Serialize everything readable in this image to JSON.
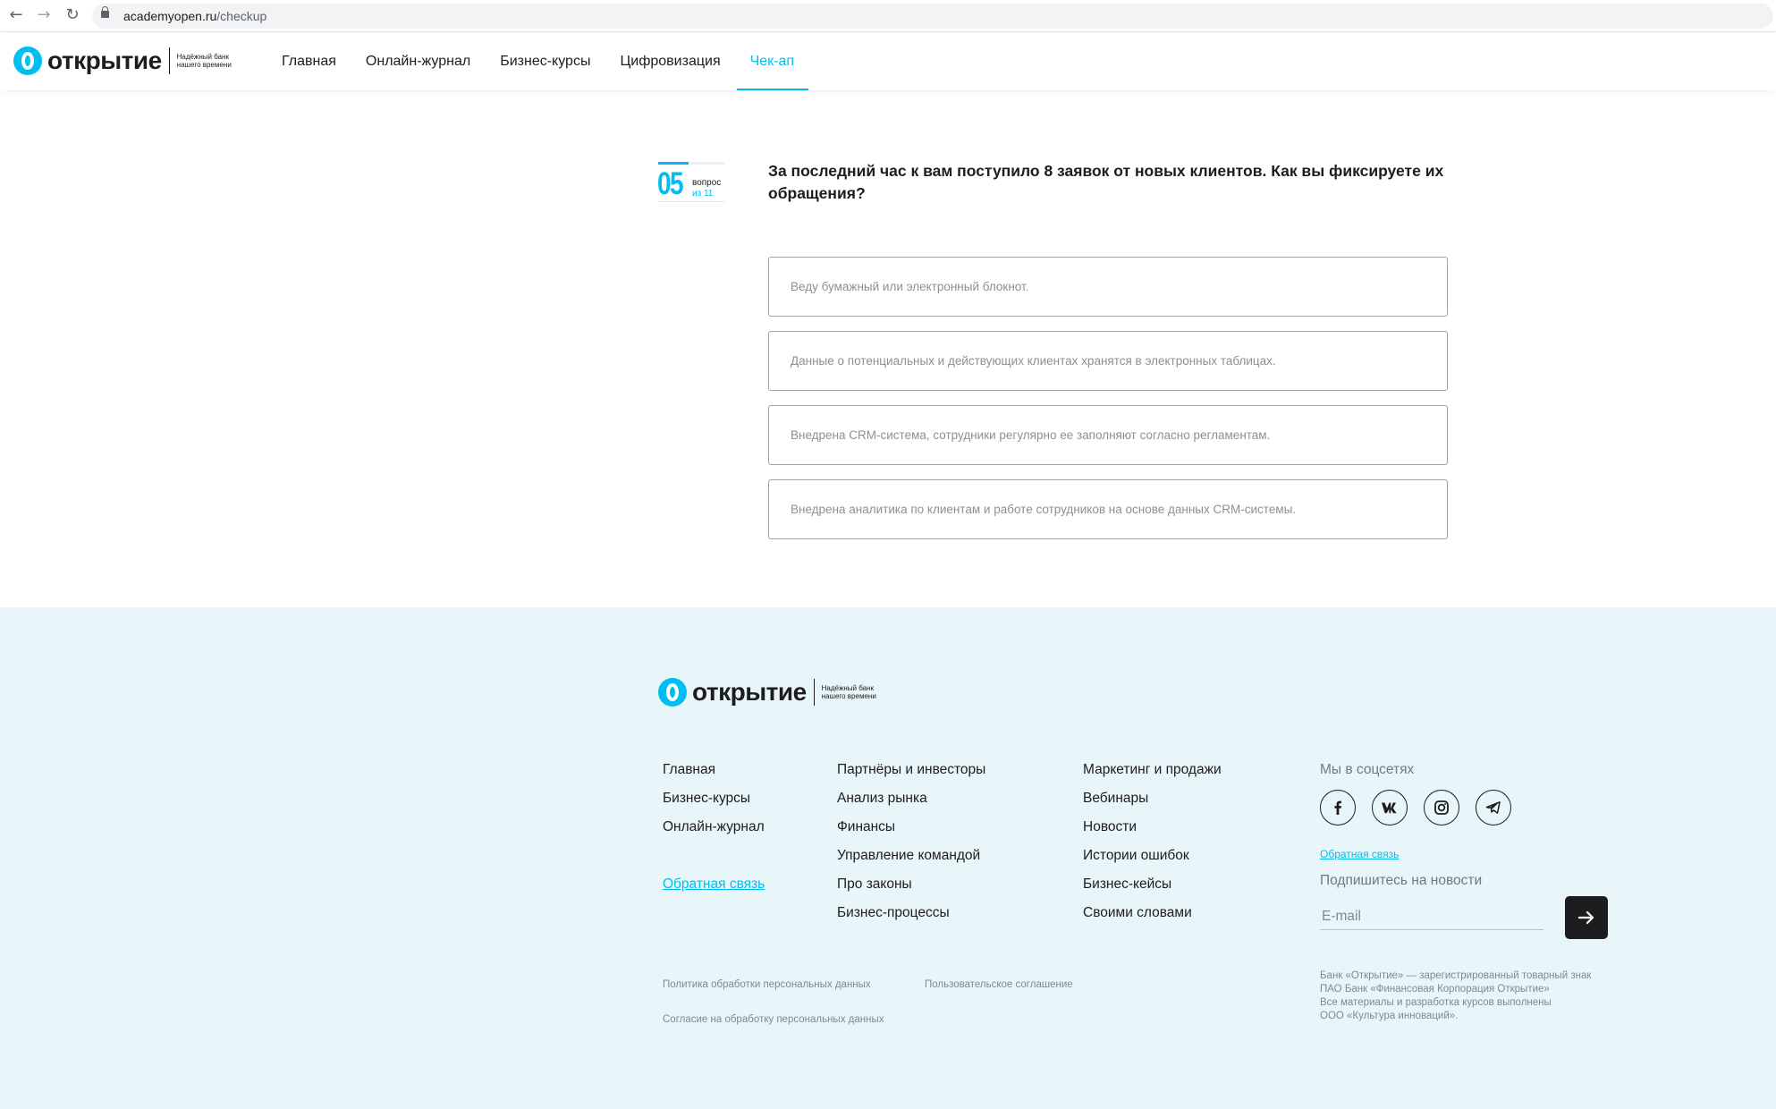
{
  "browser": {
    "url_host": "academyopen.ru",
    "url_path": "/checkup"
  },
  "header": {
    "logo_word": "открытие",
    "logo_tagline": "Надёжный банк нашего времени",
    "nav": [
      {
        "label": "Главная",
        "active": false
      },
      {
        "label": "Онлайн-журнал",
        "active": false
      },
      {
        "label": "Бизнес-курсы",
        "active": false
      },
      {
        "label": "Цифровизация",
        "active": false
      },
      {
        "label": "Чек-ап",
        "active": true
      }
    ]
  },
  "quiz": {
    "question_number": "05",
    "question_word": "вопрос",
    "question_of": "из 11",
    "progress_fraction": 0.4545,
    "question_text": "За последний час к вам поступило 8 заявок от новых клиентов. Как вы фиксируете их обращения?",
    "answers": [
      "Веду бумажный или электронный блокнот.",
      "Данные о потенциальных и действующих клиентах хранятся в электронных таблицах.",
      "Внедрена CRM-система, сотрудники регулярно ее заполняют согласно регламентам.",
      "Внедрена аналитика по клиентам и работе сотрудников на основе данных CRM-системы."
    ]
  },
  "footer": {
    "logo_word": "открытие",
    "logo_tagline": "Надёжный банк нашего времени",
    "col1": [
      "Главная",
      "Бизнес-курсы",
      "Онлайн-журнал"
    ],
    "col1_feedback": "Обратная связь",
    "col2": [
      "Партнёры и инвесторы",
      "Анализ рынка",
      "Финансы",
      "Управление командой",
      "Про законы",
      "Бизнес-процессы"
    ],
    "col3": [
      "Маркетинг и продажи",
      "Вебинары",
      "Новости",
      "Истории ошибок",
      "Бизнес-кейсы",
      "Своими словами"
    ],
    "social_title": "Мы в соцсетях",
    "social_icons": [
      "facebook-icon",
      "vk-icon",
      "instagram-icon",
      "telegram-icon"
    ],
    "small_feedback": "Обратная связь",
    "subscribe_title": "Подпишитесь на новости",
    "email_placeholder": "E-mail",
    "legal_links": [
      "Политика обработки персональных данных",
      "Пользовательское соглашение",
      "Согласие на обработку персональных данных"
    ],
    "legal_note": [
      "Банк «Открытие» — зарегистрированный товарный знак",
      "ПАО Банк «Финансовая Корпорация Открытие»",
      "Все материалы и разработка курсов выполнены",
      "ООО «Культура инноваций»."
    ]
  },
  "colors": {
    "accent": "#00bef0",
    "footer_bg": "#e8f5f9",
    "text": "#1d1d1f",
    "muted": "#7f8a90"
  }
}
